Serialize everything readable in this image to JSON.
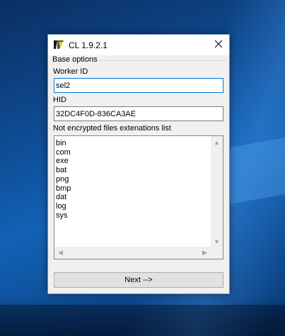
{
  "window": {
    "title": "CL 1.9.2.1",
    "icon": "app-logo-icon",
    "close_icon": "close-icon"
  },
  "base_options": {
    "title": "Base options",
    "worker_id_label": "Worker ID",
    "worker_id_value": "sel2",
    "hid_label": "HID",
    "hid_value": "32DC4F0D-836CA3AE",
    "extensions_label": "Not encrypted files extenations list",
    "extensions": [
      "bin",
      "com",
      "exe",
      "bat",
      "png",
      "bmp",
      "dat",
      "log",
      "sys"
    ]
  },
  "next_button_label": "Next -->",
  "colors": {
    "focus_border": "#0078d7",
    "window_bg": "#f0f0f0",
    "desktop_blue": "#0f4d96"
  }
}
